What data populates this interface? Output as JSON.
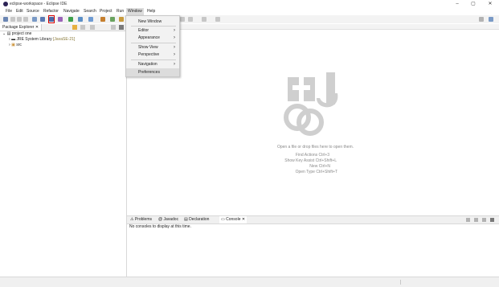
{
  "window": {
    "title": "eclipse-workspace - Eclipse IDE",
    "minimize": "–",
    "restore": "▢",
    "close": "✕"
  },
  "menu": [
    "File",
    "Edit",
    "Source",
    "Refactor",
    "Navigate",
    "Search",
    "Project",
    "Run",
    "Window",
    "Help"
  ],
  "window_menu": {
    "new_window": "New Window",
    "editor": "Editor",
    "appearance": "Appearance",
    "show_view": "Show View",
    "perspective": "Perspective",
    "navigation": "Navigation",
    "preferences": "Preferences"
  },
  "package_explorer": {
    "tab_label": "Package Explorer",
    "project": "project one",
    "jre_label": "JRE System Library",
    "jre_version": "[JavaSE-21]",
    "src": "src"
  },
  "editor": {
    "hints": [
      "Open a file or drop files here to open them.",
      "Find Actions Ctrl+3",
      "Show Key Assist Ctrl+Shift+L",
      "New Ctrl+N",
      "Open Type Ctrl+Shift+T"
    ]
  },
  "console": {
    "tabs": [
      "Problems",
      "Javadoc",
      "Declaration",
      "Console"
    ],
    "message": "No consoles to display at this time."
  },
  "colors": {
    "highlight_box": "#d40000",
    "logo_grey": "#cfcfcf"
  }
}
